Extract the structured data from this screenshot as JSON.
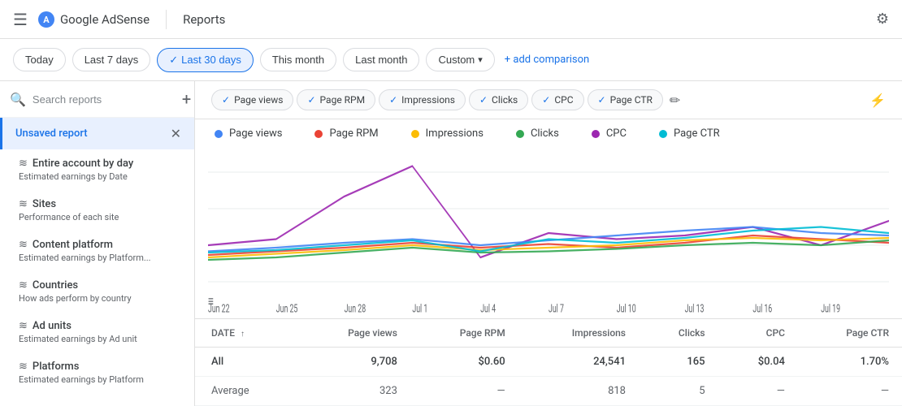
{
  "topbar": {
    "title": "Reports",
    "brand": "Google AdSense",
    "settings_label": "Settings"
  },
  "filterbar": {
    "today": "Today",
    "last7": "Last 7 days",
    "last30": "Last 30 days",
    "this_month": "This month",
    "last_month": "Last month",
    "custom": "Custom",
    "add_comparison": "+ add comparison"
  },
  "sidebar": {
    "search_placeholder": "Search reports",
    "unsaved_report": "Unsaved report",
    "items": [
      {
        "id": "entire-account",
        "title": "Entire account by day",
        "subtitle": "Estimated earnings by Date",
        "icon": "wavy"
      },
      {
        "id": "sites",
        "title": "Sites",
        "subtitle": "Performance of each site",
        "icon": "wavy"
      },
      {
        "id": "content-platform",
        "title": "Content platform",
        "subtitle": "Estimated earnings by Platform...",
        "icon": "wavy"
      },
      {
        "id": "countries",
        "title": "Countries",
        "subtitle": "How ads perform by country",
        "icon": "wavy"
      },
      {
        "id": "ad-units",
        "title": "Ad units",
        "subtitle": "Estimated earnings by Ad unit",
        "icon": "wavy"
      },
      {
        "id": "platforms",
        "title": "Platforms",
        "subtitle": "Estimated earnings by Platform",
        "icon": "wavy"
      }
    ]
  },
  "chips": [
    {
      "label": "Page views",
      "active": true,
      "color": "#4285f4"
    },
    {
      "label": "Page RPM",
      "active": true,
      "color": "#ea4335"
    },
    {
      "label": "Impressions",
      "active": true,
      "color": "#fbbc04"
    },
    {
      "label": "Clicks",
      "active": true,
      "color": "#34a853"
    },
    {
      "label": "CPC",
      "active": true,
      "color": "#9c27b0"
    },
    {
      "label": "Page CTR",
      "active": true,
      "color": "#00bcd4"
    }
  ],
  "legend": [
    {
      "label": "Page views",
      "color": "#4285f4"
    },
    {
      "label": "Page RPM",
      "color": "#ea4335"
    },
    {
      "label": "Impressions",
      "color": "#fbbc04"
    },
    {
      "label": "Clicks",
      "color": "#34a853"
    },
    {
      "label": "CPC",
      "color": "#9c27b0"
    },
    {
      "label": "Page CTR",
      "color": "#00bcd4"
    }
  ],
  "chart": {
    "x_labels": [
      "Jun 22",
      "Jun 25",
      "Jun 28",
      "Jul 1",
      "Jul 4",
      "Jul 7",
      "Jul 10",
      "Jul 13",
      "Jul 16",
      "Jul 19"
    ]
  },
  "table": {
    "columns": [
      "DATE",
      "Page views",
      "Page RPM",
      "Impressions",
      "Clicks",
      "CPC",
      "Page CTR"
    ],
    "rows": [
      {
        "label": "All",
        "page_views": "9,708",
        "page_rpm": "$0.60",
        "impressions": "24,541",
        "clicks": "165",
        "cpc": "$0.04",
        "page_ctr": "1.70%"
      },
      {
        "label": "Average",
        "page_views": "323",
        "page_rpm": "—",
        "impressions": "818",
        "clicks": "5",
        "cpc": "—",
        "page_ctr": "—"
      }
    ]
  }
}
